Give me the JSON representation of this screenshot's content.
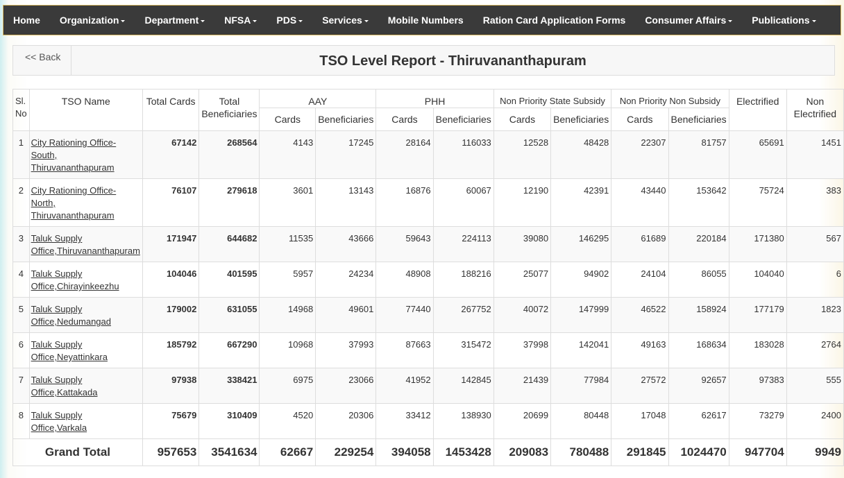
{
  "nav": [
    {
      "label": "Home",
      "dropdown": false
    },
    {
      "label": "Organization",
      "dropdown": true
    },
    {
      "label": "Department",
      "dropdown": true
    },
    {
      "label": "NFSA",
      "dropdown": true
    },
    {
      "label": "PDS",
      "dropdown": true
    },
    {
      "label": "Services",
      "dropdown": true
    },
    {
      "label": "Mobile Numbers",
      "dropdown": false
    },
    {
      "label": "Ration Card Application Forms",
      "dropdown": false
    },
    {
      "label": "Consumer Affairs",
      "dropdown": true
    },
    {
      "label": "Publications",
      "dropdown": true
    }
  ],
  "back_label": "<< Back",
  "title": "TSO Level Report - Thiruvananthapuram",
  "headers": {
    "sl": "Sl. No",
    "name": "TSO Name",
    "total_cards": "Total Cards",
    "total_ben": "Total Beneficiaries",
    "aay": "AAY",
    "phh": "PHH",
    "nps": "Non Priority State Subsidy",
    "npns": "Non Priority Non Subsidy",
    "elec": "Electrified",
    "nonelec": "Non Electrified",
    "cards": "Cards",
    "ben": "Beneficiaries"
  },
  "rows": [
    [
      "1",
      "City Rationing Office-South, Thiruvananthapuram",
      "67142",
      "268564",
      "4143",
      "17245",
      "28164",
      "116033",
      "12528",
      "48428",
      "22307",
      "81757",
      "65691",
      "1451"
    ],
    [
      "2",
      "City Rationing Office-North, Thiruvananthapuram",
      "76107",
      "279618",
      "3601",
      "13143",
      "16876",
      "60067",
      "12190",
      "42391",
      "43440",
      "153642",
      "75724",
      "383"
    ],
    [
      "3",
      "Taluk Supply Office,Thiruvananthapuram",
      "171947",
      "644682",
      "11535",
      "43666",
      "59643",
      "224113",
      "39080",
      "146295",
      "61689",
      "220184",
      "171380",
      "567"
    ],
    [
      "4",
      "Taluk Supply Office,Chirayinkeezhu",
      "104046",
      "401595",
      "5957",
      "24234",
      "48908",
      "188216",
      "25077",
      "94902",
      "24104",
      "86055",
      "104040",
      "6"
    ],
    [
      "5",
      "Taluk Supply Office,Nedumangad",
      "179002",
      "631055",
      "14968",
      "49601",
      "77440",
      "267752",
      "40072",
      "147999",
      "46522",
      "158924",
      "177179",
      "1823"
    ],
    [
      "6",
      "Taluk Supply Office,Neyattinkara",
      "185792",
      "667290",
      "10968",
      "37993",
      "87663",
      "315472",
      "37998",
      "142041",
      "49163",
      "168634",
      "183028",
      "2764"
    ],
    [
      "7",
      "Taluk Supply Office,Kattakada",
      "97938",
      "338421",
      "6975",
      "23066",
      "41952",
      "142845",
      "21439",
      "77984",
      "27572",
      "92657",
      "97383",
      "555"
    ],
    [
      "8",
      "Taluk Supply Office,Varkala",
      "75679",
      "310409",
      "4520",
      "20306",
      "33412",
      "138930",
      "20699",
      "80448",
      "17048",
      "62617",
      "73279",
      "2400"
    ]
  ],
  "total": [
    "Grand Total",
    "957653",
    "3541634",
    "62667",
    "229254",
    "394058",
    "1453428",
    "209083",
    "780488",
    "291845",
    "1024470",
    "947704",
    "9949"
  ]
}
